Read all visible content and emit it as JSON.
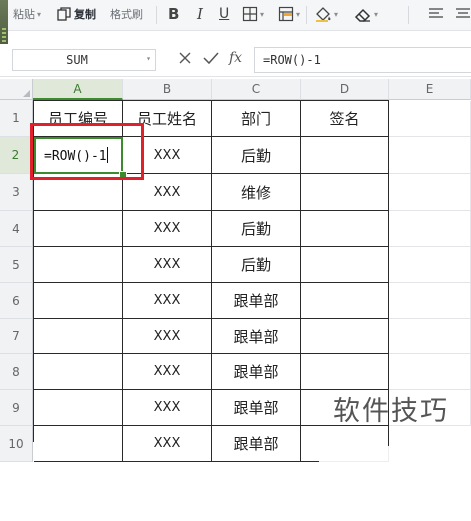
{
  "toolbar": {
    "paste_label": "粘贴",
    "copy_label": "复制",
    "format_painter_label": "格式刷",
    "bold_label": "B",
    "italic_label": "I",
    "underline_label": "U"
  },
  "formula_bar": {
    "name_box": "SUM",
    "fx_label": "fx",
    "formula": "=ROW()-1"
  },
  "columns": [
    "A",
    "B",
    "C",
    "D",
    "E"
  ],
  "rows": [
    "1",
    "2",
    "3",
    "4",
    "5",
    "6",
    "7",
    "8",
    "9",
    "10"
  ],
  "active_cell": {
    "column": "A",
    "row": "2"
  },
  "cells": {
    "header": [
      "员工编号",
      "员工姓名",
      "部门",
      "签名"
    ],
    "edit_value": "=ROW()-1",
    "names": [
      "XXX",
      "XXX",
      "XXX",
      "XXX",
      "XXX",
      "XXX",
      "XXX",
      "XXX",
      "XXX"
    ],
    "departments": [
      "后勤",
      "维修",
      "后勤",
      "后勤",
      "跟单部",
      "跟单部",
      "跟单部",
      "跟单部",
      "跟单部"
    ]
  },
  "watermark": "软件技巧",
  "colors": {
    "selection": "#3c8c2f",
    "highlight": "#e0202b"
  }
}
